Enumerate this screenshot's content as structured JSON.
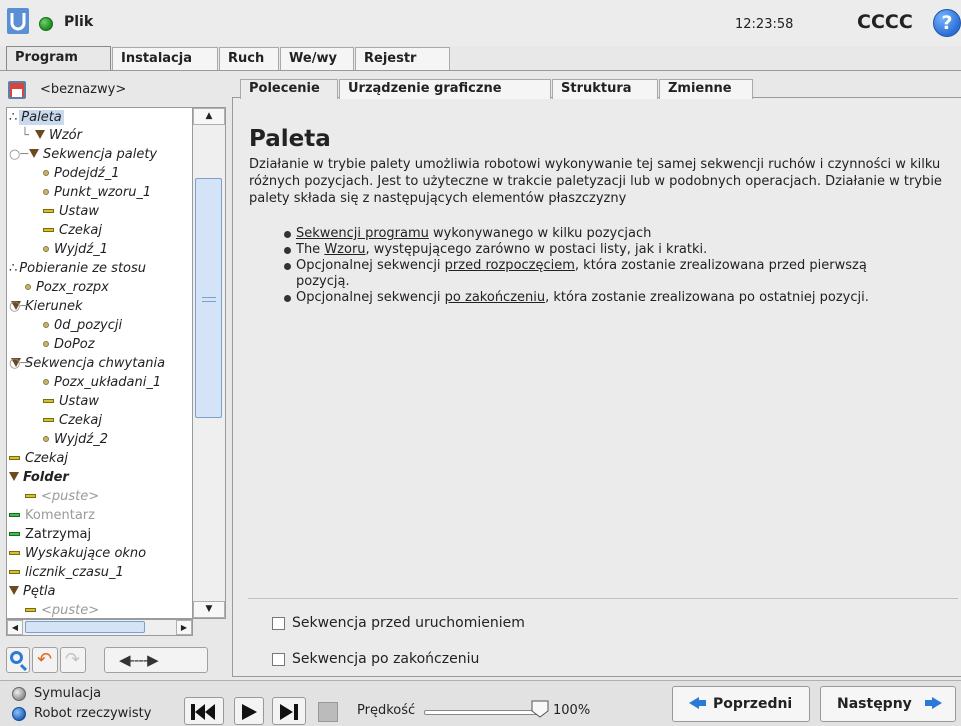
{
  "titlebar": {
    "app_title": "Plik",
    "clock": "12:23:58",
    "robot_name": "CCCC",
    "help_label": "?"
  },
  "main_tabs": [
    {
      "label": "Program"
    },
    {
      "label": "Instalacja"
    },
    {
      "label": "Ruch"
    },
    {
      "label": "We/wy"
    },
    {
      "label": "Rejestr"
    }
  ],
  "file": {
    "name": "<beznazwy>"
  },
  "tree": [
    {
      "label": "Paleta"
    },
    {
      "label": "Wzór"
    },
    {
      "label": "Sekwencja palety"
    },
    {
      "label": "Podejdź_1"
    },
    {
      "label": "Punkt_wzoru_1"
    },
    {
      "label": "Ustaw"
    },
    {
      "label": "Czekaj"
    },
    {
      "label": "Wyjdź_1"
    },
    {
      "label": "Pobieranie ze stosu"
    },
    {
      "label": "Pozx_rozpx"
    },
    {
      "label": "Kierunek"
    },
    {
      "label": "0d_pozycji"
    },
    {
      "label": "DoPoz"
    },
    {
      "label": "Sekwencja chwytania"
    },
    {
      "label": "Pozx_układani_1"
    },
    {
      "label": "Ustaw"
    },
    {
      "label": "Czekaj"
    },
    {
      "label": "Wyjdź_2"
    },
    {
      "label": "Czekaj"
    },
    {
      "label": "Folder"
    },
    {
      "label": "<puste>"
    },
    {
      "label": "Komentarz"
    },
    {
      "label": "Zatrzymaj"
    },
    {
      "label": "Wyskakujące okno"
    },
    {
      "label": "licznik_czasu_1"
    },
    {
      "label": "Pętla"
    },
    {
      "label": "<puste>"
    }
  ],
  "sub_tabs": [
    {
      "label": "Polecenie"
    },
    {
      "label": "Urządzenie graficzne"
    },
    {
      "label": "Struktura"
    },
    {
      "label": "Zmienne"
    }
  ],
  "command": {
    "title": "Paleta",
    "description": "Działanie w trybie palety umożliwia robotowi wykonywanie tej samej sekwencji ruchów i czynności w kilku różnych pozycjach. Jest to użyteczne w trakcie paletyzacji lub w podobnych operacjach. Działanie w trybie palety składa się z następujących elementów płaszczyzny",
    "items": [
      {
        "link": "Sekwencji programu",
        "text": " wykonywanego w kilku pozycjach",
        "pre": ""
      },
      {
        "pre": "The ",
        "link": "Wzoru",
        "text": ", występującego zarówno w postaci listy, jak i kratki."
      },
      {
        "pre": "Opcjonalnej sekwencji ",
        "link": "przed rozpoczęciem",
        "text": ", która zostanie zrealizowana przed pierwszą pozycją."
      },
      {
        "pre": "Opcjonalnej sekwencji ",
        "link": "po zakończeniu",
        "text": ", która zostanie zrealizowana po ostatniej pozycji."
      }
    ],
    "options": [
      {
        "label": "Sekwencja przed uruchomieniem",
        "checked": false
      },
      {
        "label": "Sekwencja po zakończeniu",
        "checked": false
      }
    ]
  },
  "tree_tools": {
    "move_label": "◀----▶"
  },
  "footer": {
    "mode_sim": "Symulacja",
    "mode_real": "Robot rzeczywisty",
    "speed_label": "Prędkość",
    "speed_value": "100%",
    "speed_fraction": 1.0,
    "prev_label": "Poprzedni",
    "next_label": "Następny"
  },
  "colors": {
    "accent_blue": "#2b7ad6",
    "tree_marker_yellow": "#d7c22e",
    "tree_marker_green": "#3ec14b",
    "folder_brown": "#6b4a1e"
  },
  "icons": [
    "ur-logo-icon",
    "status-dot-icon",
    "help-icon",
    "save-icon",
    "search-icon",
    "undo-icon",
    "redo-icon",
    "move-arrows-icon",
    "rewind-icon",
    "play-icon",
    "step-icon",
    "stop-icon",
    "arrow-left-icon",
    "arrow-right-icon"
  ]
}
